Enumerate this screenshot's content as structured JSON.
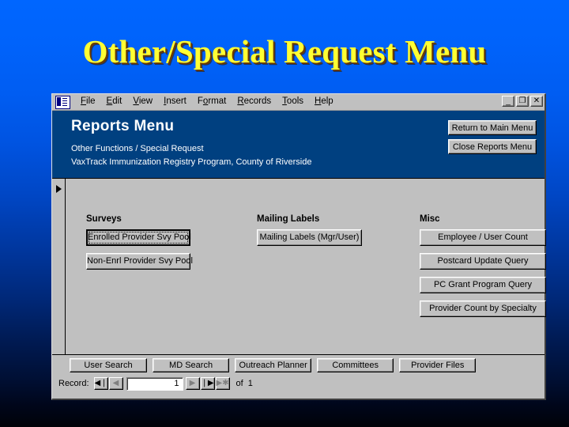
{
  "slide": {
    "title": "Other/Special Request Menu",
    "title_color": "#FFFF33",
    "background_top_color": "#0066FF",
    "background_bottom_color": "#000208"
  },
  "window": {
    "app_icon": "access-form-icon",
    "menus": [
      {
        "label": "File",
        "accel": "F"
      },
      {
        "label": "Edit",
        "accel": "E"
      },
      {
        "label": "View",
        "accel": "V"
      },
      {
        "label": "Insert",
        "accel": "I"
      },
      {
        "label": "Format",
        "accel": "o"
      },
      {
        "label": "Records",
        "accel": "R"
      },
      {
        "label": "Tools",
        "accel": "T"
      },
      {
        "label": "Help",
        "accel": "H"
      }
    ],
    "controls": {
      "minimize": "_",
      "restore": "❐",
      "close": "✕"
    }
  },
  "header": {
    "title": "Reports Menu",
    "subtitle1": "Other Functions / Special Request",
    "subtitle2": "VaxTrack Immunization Registry Program, County of Riverside",
    "band_color": "#004080",
    "return_button": "Return to Main Menu",
    "close_button": "Close Reports Menu"
  },
  "sections": {
    "surveys": {
      "label": "Surveys",
      "buttons": [
        "Enrolled Provider Svy Pool",
        "Non-Enrl Provider Svy Pool"
      ]
    },
    "mailing_labels": {
      "label": "Mailing Labels",
      "buttons": [
        "Mailing Labels (Mgr/User)"
      ]
    },
    "misc": {
      "label": "Misc",
      "buttons": [
        "Employee / User Count",
        "Postcard Update Query",
        "PC Grant Program Query",
        "Provider Count by Specialty"
      ]
    }
  },
  "footer": {
    "buttons": [
      "User Search",
      "MD Search",
      "Outreach Planner",
      "Committees",
      "Provider Files"
    ]
  },
  "record_nav": {
    "label": "Record:",
    "first": "◀❘",
    "prev": "◀",
    "value": "1",
    "next": "▶",
    "last": "❘▶",
    "new": "▶✱",
    "of": "of",
    "total": "1"
  }
}
